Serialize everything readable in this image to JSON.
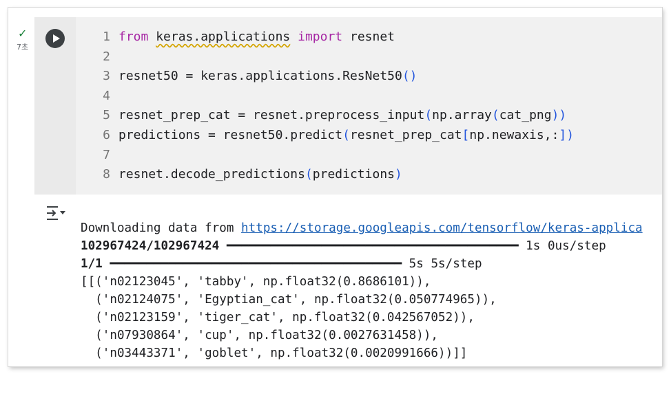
{
  "cell": {
    "status_icon": "check-icon",
    "exec_time": "7초",
    "run_icon": "play-icon",
    "code_lines": [
      {
        "num": "1",
        "tokens": [
          {
            "t": "from",
            "c": "kw"
          },
          {
            "t": " "
          },
          {
            "t": "keras.applications",
            "c": "squig"
          },
          {
            "t": " "
          },
          {
            "t": "import",
            "c": "kw"
          },
          {
            "t": " resnet"
          }
        ]
      },
      {
        "num": "2",
        "tokens": []
      },
      {
        "num": "3",
        "tokens": [
          {
            "t": "resnet50 = keras.applications.ResNet50"
          },
          {
            "t": "()",
            "c": "br"
          }
        ]
      },
      {
        "num": "4",
        "tokens": []
      },
      {
        "num": "5",
        "tokens": [
          {
            "t": "resnet_prep_cat = resnet.preprocess_input"
          },
          {
            "t": "(",
            "c": "br"
          },
          {
            "t": "np.array"
          },
          {
            "t": "(",
            "c": "br"
          },
          {
            "t": "cat_png"
          },
          {
            "t": "))",
            "c": "br"
          }
        ]
      },
      {
        "num": "6",
        "tokens": [
          {
            "t": "predictions = resnet50.predict"
          },
          {
            "t": "(",
            "c": "br"
          },
          {
            "t": "resnet_prep_cat"
          },
          {
            "t": "[",
            "c": "br"
          },
          {
            "t": "np.newaxis,:"
          },
          {
            "t": "])",
            "c": "br"
          }
        ]
      },
      {
        "num": "7",
        "tokens": []
      },
      {
        "num": "8",
        "tokens": [
          {
            "t": "resnet.decode_predictions"
          },
          {
            "t": "(",
            "c": "br"
          },
          {
            "t": "predictions"
          },
          {
            "t": ")",
            "c": "br"
          }
        ]
      }
    ]
  },
  "output": {
    "toggle_icon": "output-toggle-icon",
    "download_prefix": "Downloading data from ",
    "download_url": "https://storage.googleapis.com/tensorflow/keras-applica",
    "progress1_count": "102967424/102967424",
    "progress1_bar": "━━━━━━━━━━━━━━━━━━━━━━━━━━━━━━━━━━━━━━━━",
    "progress1_time": "1s",
    "progress1_rate": "0us/step",
    "progress1_fraction": 1.0,
    "progress2_count": "1/1",
    "progress2_bar": "━━━━━━━━━━━━━━━━━━━━━━━━━━━━━━━━━━━━━━━━",
    "progress2_time": "5s",
    "progress2_rate": "5s/step",
    "progress2_fraction": 1.0,
    "results": [
      "[[('n02123045', 'tabby', np.float32(0.8686101)),",
      "  ('n02124075', 'Egyptian_cat', np.float32(0.050774965)),",
      "  ('n02123159', 'tiger_cat', np.float32(0.042567052)),",
      "  ('n07930864', 'cup', np.float32(0.0027631458)),",
      "  ('n03443371', 'goblet', np.float32(0.0020991666))]]"
    ]
  }
}
